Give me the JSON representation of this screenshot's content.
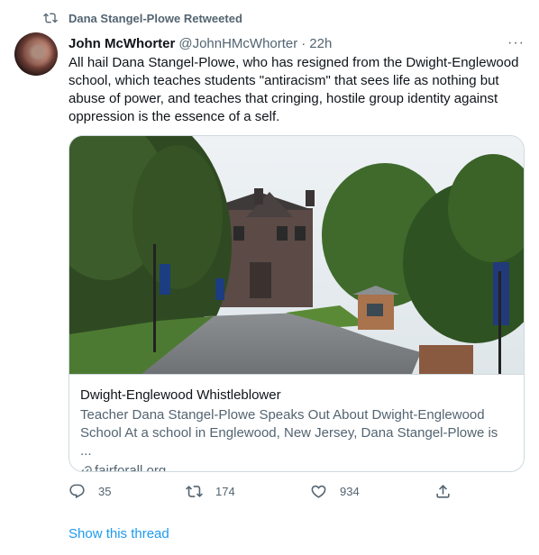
{
  "retweet": {
    "label": "Dana Stangel-Plowe Retweeted",
    "icon": "retweet-icon"
  },
  "tweet": {
    "author_name": "John McWhorter",
    "author_handle": "@JohnHMcWhorter",
    "separator": "·",
    "time": "22h",
    "more_label": "···",
    "text": "All hail Dana Stangel-Plowe, who has resigned from the Dwight-Englewood school, which teaches students \"antiracism\" that sees life as nothing but abuse of power, and teaches that cringing, hostile group identity against oppression is the essence of a self."
  },
  "card": {
    "title": "Dwight-Englewood Whistleblower",
    "description_line1": "Teacher Dana Stangel-Plowe Speaks Out About Dwight-Englewood",
    "description_line2": "School At a school in Englewood, New Jersey, Dana Stangel-Plowe is ...",
    "domain": "fairforall.org"
  },
  "actions": {
    "reply_count": "35",
    "retweet_count": "174",
    "like_count": "934"
  },
  "show_thread": "Show this thread",
  "colors": {
    "text": "#0f1419",
    "secondary": "#536471",
    "link": "#1d9bf0",
    "border": "#cfd9de"
  }
}
